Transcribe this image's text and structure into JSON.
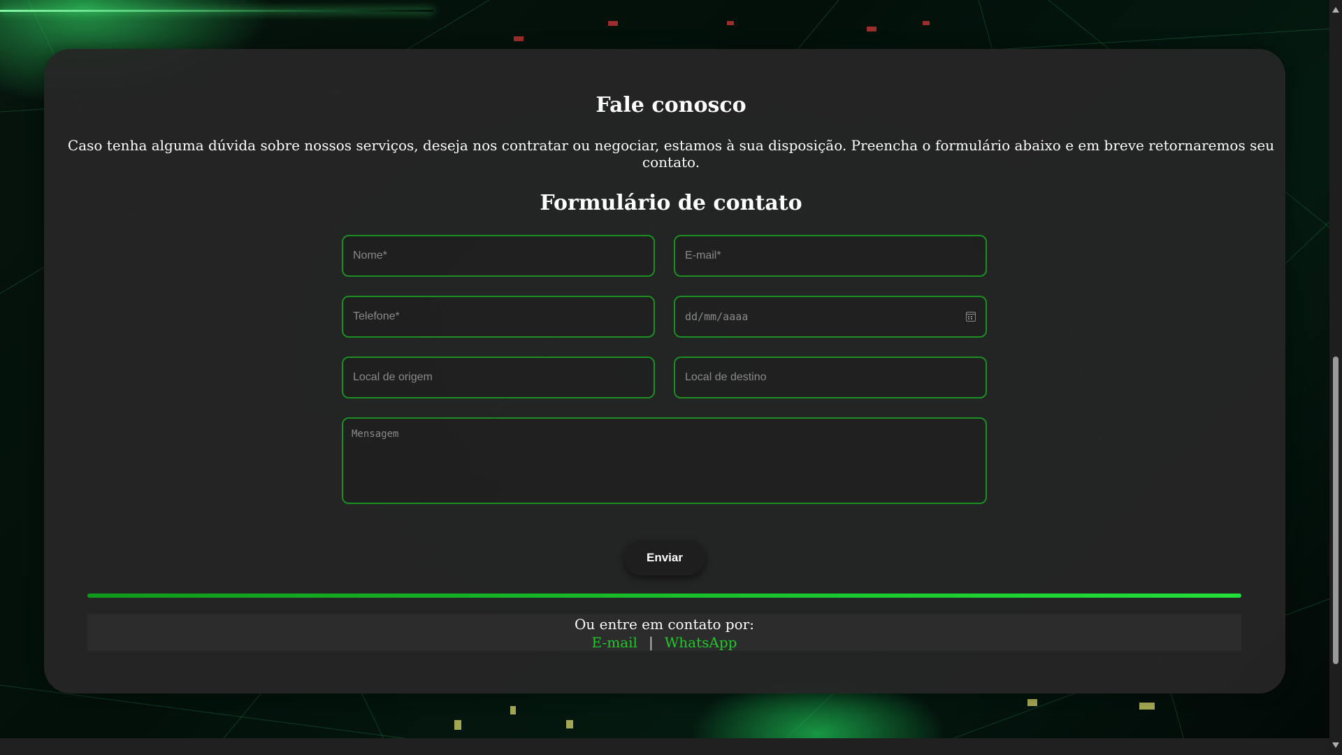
{
  "page": {
    "heading": "Fale conosco",
    "intro": "Caso tenha alguma dúvida sobre nossos serviços, deseja nos contratar ou negociar, estamos à sua disposição. Preencha o formulário abaixo e em breve retornaremos seu contato."
  },
  "form": {
    "title": "Formulário de contato",
    "fields": {
      "name_placeholder": "Nome*",
      "email_placeholder": "E-mail*",
      "phone_placeholder": "Telefone*",
      "date_placeholder": "dd/mm/aaaa",
      "origin_placeholder": "Local de origem",
      "destination_placeholder": "Local de destino",
      "message_placeholder": "Mensagem"
    },
    "submit_label": "Enviar"
  },
  "contact": {
    "label": "Ou entre em contato por:",
    "email_link": "E-mail",
    "separator": "|",
    "whatsapp_link": "WhatsApp"
  },
  "icons": {
    "date_field": "calendar-icon"
  },
  "colors": {
    "accent": "#21c72b",
    "field_border": "#1c8f22",
    "panel": "#262626"
  }
}
